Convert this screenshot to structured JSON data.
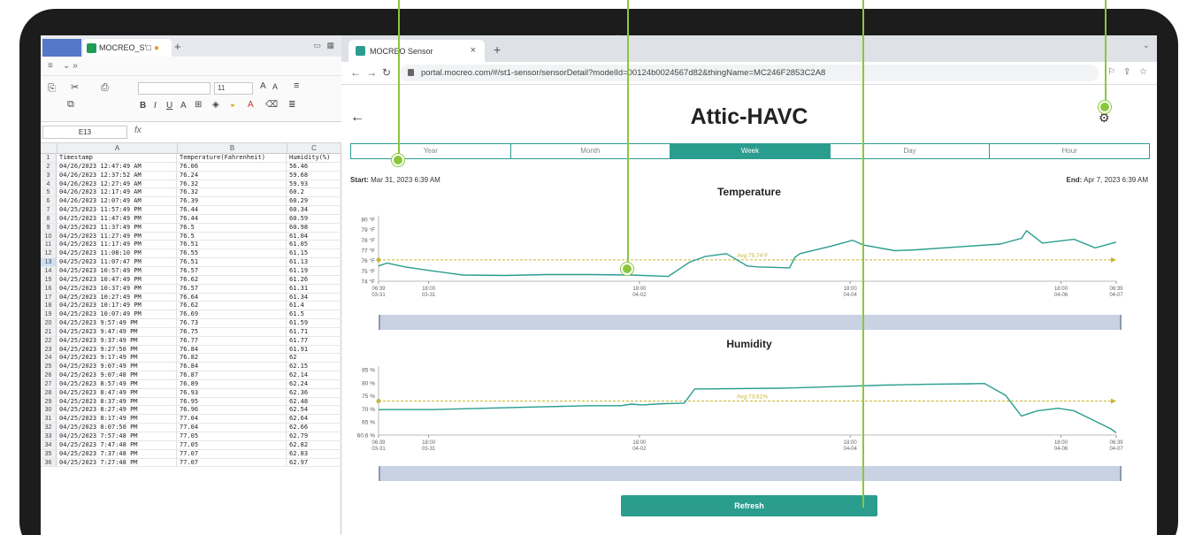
{
  "spreadsheet": {
    "tab_label": "MOCREO_S’□",
    "name_box": "E13",
    "fx_label": "fx",
    "font_size": "11",
    "columns": [
      "A",
      "B",
      "C"
    ],
    "rows": [
      [
        "1",
        "Timestamp",
        "Temperature(Fahrenheit)",
        "Humidity(%)"
      ],
      [
        "2",
        "04/26/2023 12:47:49 AM",
        "76.06",
        "56.46"
      ],
      [
        "3",
        "04/26/2023 12:37:52 AM",
        "76.24",
        "59.68"
      ],
      [
        "4",
        "04/26/2023 12:27:49 AM",
        "76.32",
        "59.93"
      ],
      [
        "5",
        "04/26/2023 12:17:49 AM",
        "76.32",
        "60.2"
      ],
      [
        "6",
        "04/26/2023 12:07:49 AM",
        "76.39",
        "60.29"
      ],
      [
        "7",
        "04/25/2023 11:57:49 PM",
        "76.44",
        "60.34"
      ],
      [
        "8",
        "04/25/2023 11:47:49 PM",
        "76.44",
        "60.59"
      ],
      [
        "9",
        "04/25/2023 11:37:49 PM",
        "76.5",
        "60.98"
      ],
      [
        "10",
        "04/25/2023 11:27:49 PM",
        "76.5",
        "61.04"
      ],
      [
        "11",
        "04/25/2023 11:17:49 PM",
        "76.51",
        "61.05"
      ],
      [
        "12",
        "04/25/2023 11:08:10 PM",
        "76.55",
        "61.15"
      ],
      [
        "13",
        "04/25/2023 11:07:47 PM",
        "76.51",
        "61.13"
      ],
      [
        "14",
        "04/25/2023 10:57:49 PM",
        "76.57",
        "61.19"
      ],
      [
        "15",
        "04/25/2023 10:47:49 PM",
        "76.62",
        "61.26"
      ],
      [
        "16",
        "04/25/2023 10:37:49 PM",
        "76.57",
        "61.31"
      ],
      [
        "17",
        "04/25/2023 10:27:49 PM",
        "76.64",
        "61.34"
      ],
      [
        "18",
        "04/25/2023 10:17:49 PM",
        "76.62",
        "61.4"
      ],
      [
        "19",
        "04/25/2023 10:07:49 PM",
        "76.69",
        "61.5"
      ],
      [
        "20",
        "04/25/2023 9:57:49 PM",
        "76.73",
        "61.59"
      ],
      [
        "21",
        "04/25/2023 9:47:49 PM",
        "76.75",
        "61.71"
      ],
      [
        "22",
        "04/25/2023 9:37:49 PM",
        "76.77",
        "61.77"
      ],
      [
        "23",
        "04/25/2023 9:27:50 PM",
        "76.84",
        "61.91"
      ],
      [
        "24",
        "04/25/2023 9:17:49 PM",
        "76.82",
        "62"
      ],
      [
        "25",
        "04/25/2023 9:07:49 PM",
        "76.84",
        "62.15"
      ],
      [
        "26",
        "04/25/2023 9:07:48 PM",
        "76.87",
        "62.14"
      ],
      [
        "27",
        "04/25/2023 8:57:49 PM",
        "76.89",
        "62.24"
      ],
      [
        "28",
        "04/25/2023 8:47:49 PM",
        "76.93",
        "62.36"
      ],
      [
        "29",
        "04/25/2023 8:37:49 PM",
        "76.95",
        "62.48"
      ],
      [
        "30",
        "04/25/2023 8:27:49 PM",
        "76.96",
        "62.54"
      ],
      [
        "31",
        "04/25/2023 8:17:49 PM",
        "77.04",
        "62.64"
      ],
      [
        "32",
        "04/25/2023 8:07:50 PM",
        "77.04",
        "62.66"
      ],
      [
        "33",
        "04/25/2023 7:57:48 PM",
        "77.05",
        "62.79"
      ],
      [
        "34",
        "04/25/2023 7:47:48 PM",
        "77.05",
        "62.82"
      ],
      [
        "35",
        "04/25/2023 7:37:48 PM",
        "77.07",
        "62.83"
      ],
      [
        "36",
        "04/25/2023 7:27:48 PM",
        "77.07",
        "62.97"
      ]
    ],
    "highlighted_row": "13"
  },
  "browser": {
    "tab_title": "MOCREO Sensor",
    "url": "portal.mocreo.com/#/st1-sensor/sensorDetail?modelId=00124b0024567d82&thingName=MC246F2853C2A8"
  },
  "app": {
    "title": "Attic-HAVC",
    "range_tabs": [
      "Year",
      "Month",
      "Week",
      "Day",
      "Hour"
    ],
    "active_tab": "Week",
    "start_label": "Start:",
    "start_value": "Mar 31, 2023 6:39 AM",
    "end_label": "End:",
    "end_value": "Apr 7, 2023 6:39 AM",
    "refresh_label": "Refresh"
  },
  "colors": {
    "accent": "#2a9d8f",
    "avg_line": "#c9b832",
    "callout": "#8cc63f"
  },
  "chart_data": [
    {
      "type": "line",
      "title": "Temperature",
      "y_tick_labels": [
        "80 °F",
        "79 °F",
        "78 °F",
        "77 °F",
        "76 °F",
        "75 °F",
        "74 °F"
      ],
      "ylim": [
        73.5,
        80
      ],
      "x_tick_labels": [
        [
          "06:39",
          "03-31"
        ],
        [
          "18:00",
          "03-31"
        ],
        [
          "18:00",
          "04-02"
        ],
        [
          "18:00",
          "04-04"
        ],
        [
          "18:00",
          "04-06"
        ],
        [
          "06:39",
          "04-07"
        ]
      ],
      "x_ticks": [
        0,
        0.475,
        2.475,
        4.475,
        6.475,
        7
      ],
      "xlim": [
        0,
        7
      ],
      "avg_label": "Avg:75.74°F",
      "avg": 75.74,
      "x": [
        0,
        0.08,
        0.25,
        0.5,
        0.8,
        1.2,
        1.6,
        2.0,
        2.4,
        2.75,
        2.95,
        3.1,
        3.3,
        3.5,
        3.6,
        3.9,
        3.95,
        4.0,
        4.3,
        4.5,
        4.6,
        4.9,
        5.1,
        5.5,
        5.9,
        6.1,
        6.15,
        6.3,
        6.6,
        6.8,
        6.9,
        7.0
      ],
      "y": [
        75.1,
        75.4,
        75.0,
        74.6,
        74.15,
        74.1,
        74.2,
        74.2,
        74.15,
        74.0,
        75.5,
        76.1,
        76.4,
        75.1,
        75.0,
        74.9,
        76.0,
        76.4,
        77.2,
        77.8,
        77.3,
        76.7,
        76.8,
        77.1,
        77.4,
        78.0,
        78.8,
        77.5,
        77.9,
        77.0,
        77.3,
        77.6
      ]
    },
    {
      "type": "line",
      "title": "Humidity",
      "y_tick_labels": [
        "85 %",
        "80 %",
        "75 %",
        "70 %",
        "65 %",
        "60.6 %"
      ],
      "ylim": [
        60.6,
        86
      ],
      "x_tick_labels": [
        [
          "06:39",
          "03-31"
        ],
        [
          "18:00",
          "03-31"
        ],
        [
          "18:00",
          "04-02"
        ],
        [
          "18:00",
          "04-04"
        ],
        [
          "18:00",
          "04-06"
        ],
        [
          "06:39",
          "04-07"
        ]
      ],
      "x_ticks": [
        0,
        0.475,
        2.475,
        4.475,
        6.475,
        7
      ],
      "xlim": [
        0,
        7
      ],
      "avg_label": "Avg:73.81%",
      "avg": 73.81,
      "x": [
        0,
        0.5,
        1.0,
        1.5,
        2.0,
        2.3,
        2.4,
        2.5,
        2.7,
        2.9,
        3.0,
        3.8,
        4.0,
        4.4,
        4.8,
        5.2,
        5.6,
        5.75,
        5.95,
        6.1,
        6.25,
        6.45,
        6.6,
        6.8,
        6.95,
        7.0
      ],
      "y": [
        70.5,
        70.5,
        71.0,
        71.5,
        72.0,
        72.0,
        72.6,
        72.3,
        72.8,
        73.0,
        78.5,
        78.8,
        79.0,
        79.5,
        80.0,
        80.3,
        80.5,
        80.6,
        76.0,
        68.0,
        70.0,
        71.0,
        70.0,
        66.0,
        63.0,
        61.5
      ]
    }
  ]
}
